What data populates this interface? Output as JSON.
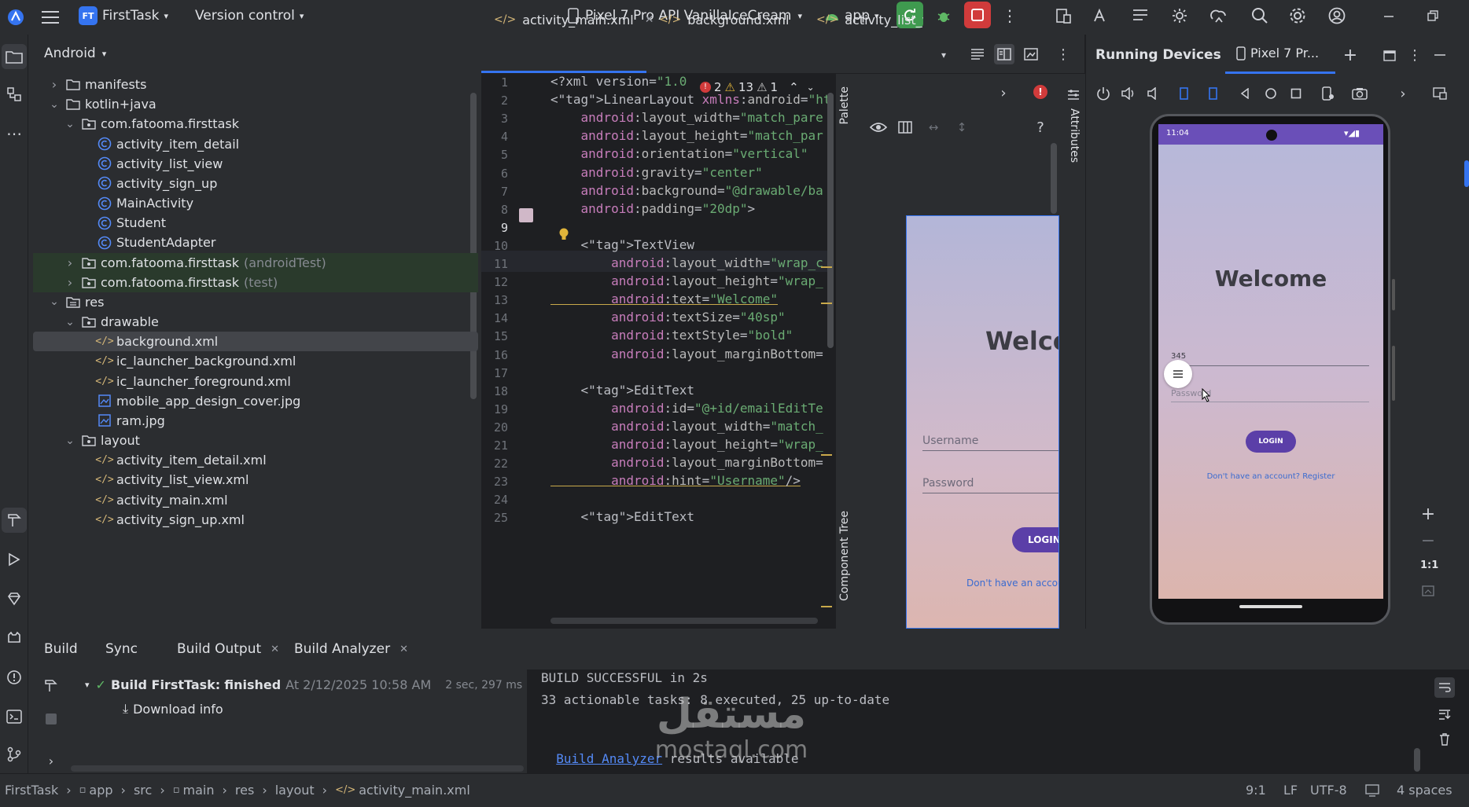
{
  "topbar": {
    "project_badge": "FT",
    "project_name": "FirstTask",
    "vcs": "Version control",
    "device": "Pixel 7 Pro API VanillaIceCream",
    "run_config": "app"
  },
  "project_panel": {
    "title": "Android",
    "items": [
      {
        "label": "manifests",
        "note": ""
      },
      {
        "label": "kotlin+java",
        "note": ""
      },
      {
        "label": "com.fatooma.firsttask",
        "note": ""
      },
      {
        "label": "activity_item_detail",
        "note": ""
      },
      {
        "label": "activity_list_view",
        "note": ""
      },
      {
        "label": "activity_sign_up",
        "note": ""
      },
      {
        "label": "MainActivity",
        "note": ""
      },
      {
        "label": "Student",
        "note": ""
      },
      {
        "label": "StudentAdapter",
        "note": ""
      },
      {
        "label": "com.fatooma.firsttask",
        "note": "(androidTest)"
      },
      {
        "label": "com.fatooma.firsttask",
        "note": "(test)"
      },
      {
        "label": "res",
        "note": ""
      },
      {
        "label": "drawable",
        "note": ""
      },
      {
        "label": "background.xml",
        "note": ""
      },
      {
        "label": "ic_launcher_background.xml",
        "note": ""
      },
      {
        "label": "ic_launcher_foreground.xml",
        "note": ""
      },
      {
        "label": "mobile_app_design_cover.jpg",
        "note": ""
      },
      {
        "label": "ram.jpg",
        "note": ""
      },
      {
        "label": "layout",
        "note": ""
      },
      {
        "label": "activity_item_detail.xml",
        "note": ""
      },
      {
        "label": "activity_list_view.xml",
        "note": ""
      },
      {
        "label": "activity_main.xml",
        "note": ""
      },
      {
        "label": "activity_sign_up.xml",
        "note": ""
      }
    ]
  },
  "editor": {
    "tabs": [
      "activity_main.xml",
      "background.xml",
      "activity_list_vi"
    ],
    "inspections": {
      "errors": "2",
      "warnings": "13",
      "weak": "1"
    },
    "line_numbers": [
      "1",
      "2",
      "3",
      "4",
      "5",
      "6",
      "7",
      "8",
      "9",
      "10",
      "11",
      "12",
      "13",
      "14",
      "15",
      "16",
      "17",
      "18",
      "19",
      "20",
      "21",
      "22",
      "23",
      "24",
      "25"
    ],
    "lines": [
      "<?xml version=\"1.0",
      "<LinearLayout xmlns:android=\"http://",
      "    android:layout_width=\"match_pare",
      "    android:layout_height=\"match_par",
      "    android:orientation=\"vertical\"",
      "    android:gravity=\"center\"",
      "    android:background=\"@drawable/ba",
      "    android:padding=\"20dp\">",
      "",
      "    <TextView",
      "        android:layout_width=\"wrap_c",
      "        android:layout_height=\"wrap_",
      "        android:text=\"Welcome\"",
      "        android:textSize=\"40sp\"",
      "        android:textStyle=\"bold\"",
      "        android:layout_marginBottom=",
      "",
      "    <EditText",
      "        android:id=\"@+id/emailEditTe",
      "        android:layout_width=\"match_",
      "        android:layout_height=\"wrap_",
      "        android:layout_marginBottom=",
      "        android:hint=\"Username\"/>",
      "",
      "    <EditText"
    ]
  },
  "design_preview": {
    "palette": "Palette",
    "component_tree": "Component Tree",
    "attributes": "Attributes",
    "welcome": "Welco",
    "username_hint": "Username",
    "password_hint": "Password",
    "login": "LOGIN",
    "register_link": "Don't have an accou"
  },
  "running_devices": {
    "title": "Running Devices",
    "tab": "Pixel 7 Pr...",
    "time": "11:04",
    "welcome": "Welcome",
    "typed": "345",
    "password_hint": "Password",
    "login": "LOGIN",
    "register": "Don't have an account? Register",
    "zoom_ratio": "1:1"
  },
  "bottom": {
    "tabs": [
      "Build",
      "Sync",
      "Build Output",
      "Build Analyzer"
    ],
    "build_task": "Build FirstTask:",
    "build_status": "finished",
    "build_time": "At 2/12/2025 10:58 AM",
    "build_duration": "2 sec, 297 ms",
    "download_info": "Download info",
    "output_line1": "BUILD SUCCESSFUL in 2s",
    "output_line2": "33 actionable tasks: 8 executed, 25 up-to-date",
    "output_link": "Build Analyzer",
    "output_line3": " results available"
  },
  "statusbar": {
    "breadcrumb": [
      "FirstTask",
      "app",
      "src",
      "main",
      "res",
      "layout",
      "activity_main.xml"
    ],
    "position": "9:1",
    "line_sep": "LF",
    "encoding": "UTF-8",
    "indent": "4 spaces"
  },
  "watermark": {
    "arabic": "مستقل",
    "site": "mostaql.com"
  },
  "colors": {
    "accent": "#3574f0",
    "login_purple": "#5b3fa8",
    "run_green": "#3f9a4f",
    "stop_red": "#d13b3b"
  }
}
